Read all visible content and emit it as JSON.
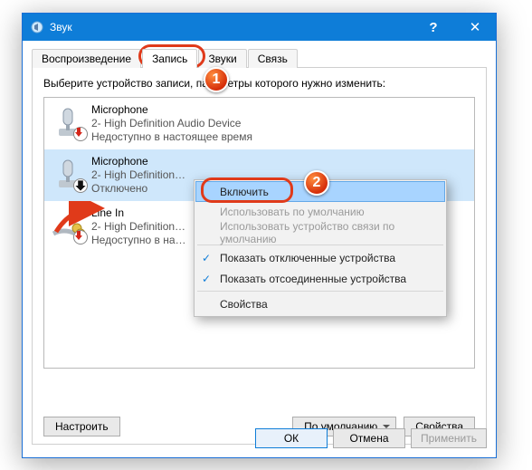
{
  "window": {
    "title": "Звук",
    "help": "?",
    "close": "✕"
  },
  "tabs": {
    "t0": "Воспроизведение",
    "t1": "Запись",
    "t2": "Звуки",
    "t3": "Связь"
  },
  "instruction": "Выберите устройство записи, параметры которого нужно изменить:",
  "devices": [
    {
      "name": "Microphone",
      "sub": "2- High Definition Audio Device",
      "state": "Недоступно в настоящее время"
    },
    {
      "name": "Microphone",
      "sub": "2- High Definition…",
      "state": "Отключено"
    },
    {
      "name": "Line In",
      "sub": "2- High Definition…",
      "state": "Недоступно в на…"
    }
  ],
  "buttons": {
    "configure": "Настроить",
    "default": "По умолчанию",
    "properties": "Свойства",
    "ok": "ОК",
    "cancel": "Отмена",
    "apply": "Применить"
  },
  "context_menu": {
    "enable": "Включить",
    "use_default": "Использовать по умолчанию",
    "use_comm_default": "Использовать устройство связи по умолчанию",
    "show_disabled": "Показать отключенные устройства",
    "show_disconnected": "Показать отсоединенные устройства",
    "props": "Свойства"
  },
  "callouts": {
    "c1": "1",
    "c2": "2"
  }
}
